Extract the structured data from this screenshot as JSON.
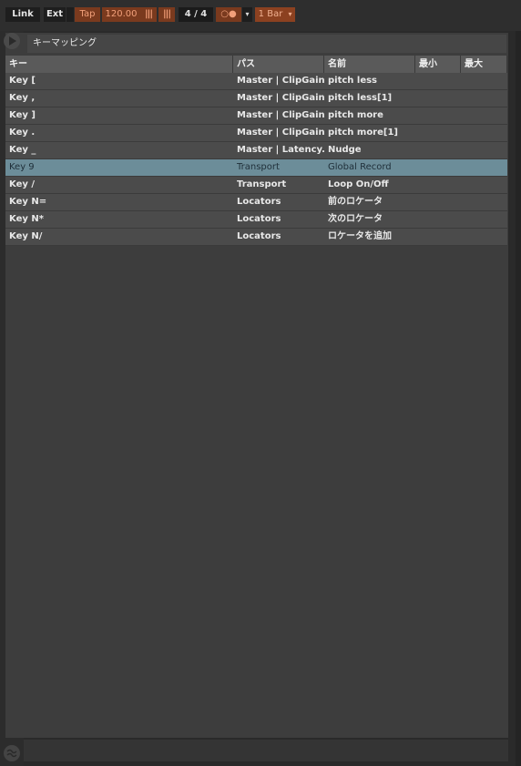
{
  "transport": {
    "link_label": "Link",
    "ext_label": "Ext",
    "tap_label": "Tap",
    "tempo": "120.00",
    "nudge_down": "|||",
    "nudge_up": "|||",
    "time_signature": "4 / 4",
    "metronome": "○●",
    "quantize": "1 Bar",
    "dropdown_arrow": "▾"
  },
  "panel": {
    "title": "キーマッピング"
  },
  "table": {
    "headers": [
      "キー",
      "パス",
      "名前",
      "最小",
      "最大"
    ],
    "rows": [
      {
        "key": "Key [",
        "path": "Master | ClipGain",
        "name": "pitch less",
        "min": "",
        "max": ""
      },
      {
        "key": "Key ,",
        "path": "Master | ClipGain",
        "name": "pitch less[1]",
        "min": "",
        "max": ""
      },
      {
        "key": "Key ]",
        "path": "Master | ClipGain",
        "name": "pitch more",
        "min": "",
        "max": ""
      },
      {
        "key": "Key .",
        "path": "Master | ClipGain",
        "name": "pitch more[1]",
        "min": "",
        "max": ""
      },
      {
        "key": "Key _",
        "path": "Master | Latency...",
        "name": "Nudge",
        "min": "",
        "max": ""
      },
      {
        "key": "Key 9",
        "path": "Transport",
        "name": "Global Record",
        "min": "",
        "max": "",
        "selected": true
      },
      {
        "key": "Key /",
        "path": "Transport",
        "name": "Loop On/Off",
        "min": "",
        "max": ""
      },
      {
        "key": "Key N=",
        "path": "Locators",
        "name": "前のロケータ",
        "min": "",
        "max": ""
      },
      {
        "key": "Key N*",
        "path": "Locators",
        "name": "次のロケータ",
        "min": "",
        "max": ""
      },
      {
        "key": "Key N/",
        "path": "Locators",
        "name": "ロケータを追加",
        "min": "",
        "max": ""
      }
    ]
  },
  "icons": {
    "play": "play-icon",
    "bottom": "browser-icon"
  }
}
